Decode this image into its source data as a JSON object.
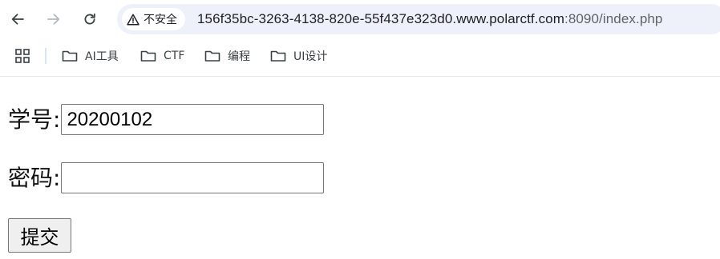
{
  "browser": {
    "security_label": "不安全",
    "url_host": "156f35bc-3263-4138-820e-55f437e323d0.www.polarctf.com",
    "url_rest": ":8090/index.php"
  },
  "bookmarks": {
    "items": [
      {
        "label": "AI工具"
      },
      {
        "label": "CTF"
      },
      {
        "label": "编程"
      },
      {
        "label": "UI设计"
      }
    ]
  },
  "form": {
    "student_id_label": "学号:",
    "student_id_value": "20200102",
    "password_label": "密码:",
    "password_value": "",
    "submit_label": "提交"
  }
}
